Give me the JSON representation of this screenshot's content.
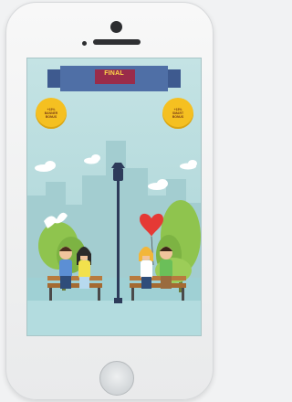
{
  "app_screen": {
    "title_ribbon": "FINAL",
    "left_badge_lines": [
      "+15%",
      "BANNER",
      "BONUS"
    ],
    "right_badge_lines": [
      "+15%",
      "SMART",
      "BONUS"
    ]
  },
  "colors": {
    "screen_bg": "#b8dbdd",
    "ribbon": "#4f6fa6",
    "badge": "#f5c021",
    "grass": "#8fc44e",
    "heart": "#e53935"
  },
  "icons": [
    "camera-icon",
    "earpiece-icon",
    "home-button-icon",
    "heart-balloon-icon",
    "lamp-post-icon",
    "bird-icon"
  ]
}
